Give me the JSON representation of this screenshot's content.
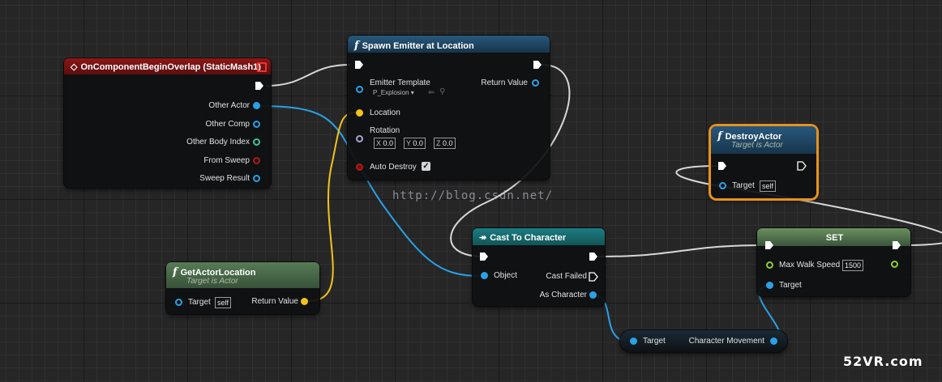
{
  "colors": {
    "exec": "#ffffff",
    "object": "#2aa1e6",
    "vector": "#f3c21b",
    "rotator": "#a6a6d2",
    "float": "#8dd12c",
    "bool": "#b21818",
    "event_header": "#7a1212",
    "function_header": "#1f4766",
    "pure_header": "#4e6e4c",
    "cast_header": "#176a6e",
    "set_header": "#4e6e4c",
    "selected": "#e8921c"
  },
  "event": {
    "title": "OnComponentBeginOverlap (StaticMash1)",
    "pins": [
      "Other Actor",
      "Other Comp",
      "Other Body Index",
      "From Sweep",
      "Sweep Result"
    ]
  },
  "spawn": {
    "title": "Spawn Emitter at Location",
    "emitter_label": "Emitter Template",
    "emitter_value": "P_Explosion",
    "return_label": "Return Value",
    "location_label": "Location",
    "rotation_label": "Rotation",
    "rx_label": "X",
    "rx": "0.0",
    "ry_label": "Y",
    "ry": "0.0",
    "rz_label": "Z",
    "rz": "0.0",
    "auto_destroy_label": "Auto Destroy",
    "auto_destroy_check": "✓"
  },
  "destroy": {
    "title": "DestroyActor",
    "subtitle": "Target is Actor",
    "target_label": "Target",
    "target_value": "self"
  },
  "getloc": {
    "title": "GetActorLocation",
    "subtitle": "Target is Actor",
    "target_label": "Target",
    "target_value": "self",
    "return_label": "Return Value"
  },
  "cast": {
    "title": "Cast To Character",
    "object_label": "Object",
    "failed_label": "Cast Failed",
    "as_label": "As Character"
  },
  "set": {
    "title": "SET",
    "speed_label": "Max Walk Speed",
    "speed_value": "1500",
    "target_label": "Target"
  },
  "cm": {
    "target_label": "Target",
    "out_label": "Character Movement"
  },
  "watermark": "http://blog.csdn.net/",
  "brand": "52VR.com",
  "icons": {
    "function": "f",
    "cast": "↠",
    "event": "◇"
  }
}
